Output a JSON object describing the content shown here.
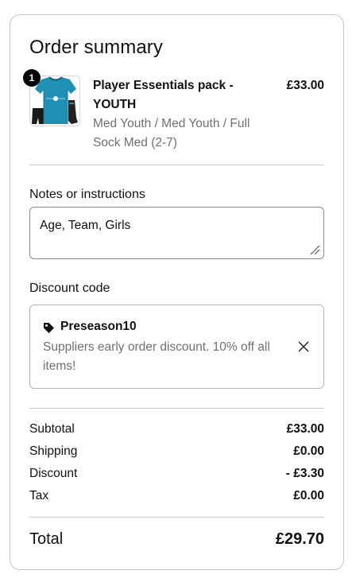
{
  "summary": {
    "title": "Order summary"
  },
  "product": {
    "quantity_badge": "1",
    "name": "Player Essentials pack - YOUTH",
    "variant": "Med Youth / Med Youth / Full Sock Med (2-7)",
    "price": "£33.00",
    "image_icon": "jersey-kit-image"
  },
  "notes": {
    "label": "Notes or instructions",
    "value": "Age, Team, Girls"
  },
  "discount": {
    "label": "Discount code",
    "code": "Preseason10",
    "description": "Suppliers early order discount. 10% off all items!",
    "tag_icon": "tag-icon",
    "remove_icon": "close-icon"
  },
  "totals": {
    "subtotal_label": "Subtotal",
    "subtotal_value": "£33.00",
    "shipping_label": "Shipping",
    "shipping_value": "£0.00",
    "discount_label": "Discount",
    "discount_value": "- £3.30",
    "tax_label": "Tax",
    "tax_value": "£0.00",
    "total_label": "Total",
    "total_value": "£29.70"
  },
  "colors": {
    "border": "#c7c7c7",
    "muted_text": "#707070",
    "jersey": "#1f8fb3"
  }
}
